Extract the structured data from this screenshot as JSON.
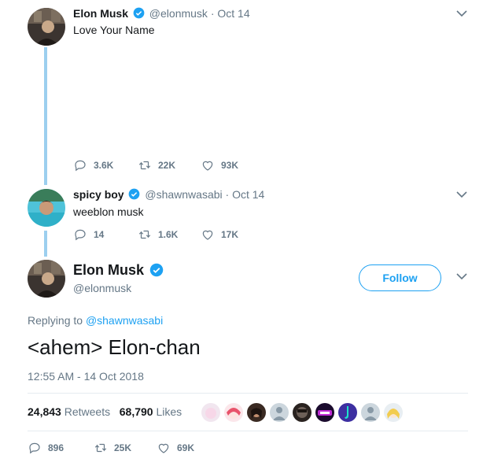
{
  "colors": {
    "accent": "#1da1f2",
    "muted": "#657786",
    "thread_line": "#9ccfef",
    "text": "#14171a"
  },
  "tweet1": {
    "name": "Elon Musk",
    "handle": "@elonmusk",
    "dot": "·",
    "time": "Oct 14",
    "text": "Love Your Name",
    "replies": "3.6K",
    "retweets": "22K",
    "likes": "93K"
  },
  "tweet2": {
    "name": "spicy boy",
    "handle": "@shawnwasabi",
    "dot": "·",
    "time": "Oct 14",
    "text": "weeblon musk",
    "replies": "14",
    "retweets": "1.6K",
    "likes": "17K"
  },
  "main": {
    "name": "Elon Musk",
    "handle": "@elonmusk",
    "follow_label": "Follow",
    "replying_prefix": "Replying to",
    "replying_to": "@shawnwasabi",
    "text": "<ahem> Elon-chan",
    "timestamp": "12:55 AM - 14 Oct 2018",
    "retweets_count": "24,843",
    "retweets_label": "Retweets",
    "likes_count": "68,790",
    "likes_label": "Likes",
    "replies": "896",
    "retweets": "25K",
    "likes": "69K"
  },
  "icons": {
    "reply": "reply-icon",
    "retweet": "retweet-icon",
    "like": "heart-icon",
    "verified": "verified-badge-icon",
    "more": "chevron-down-icon"
  }
}
